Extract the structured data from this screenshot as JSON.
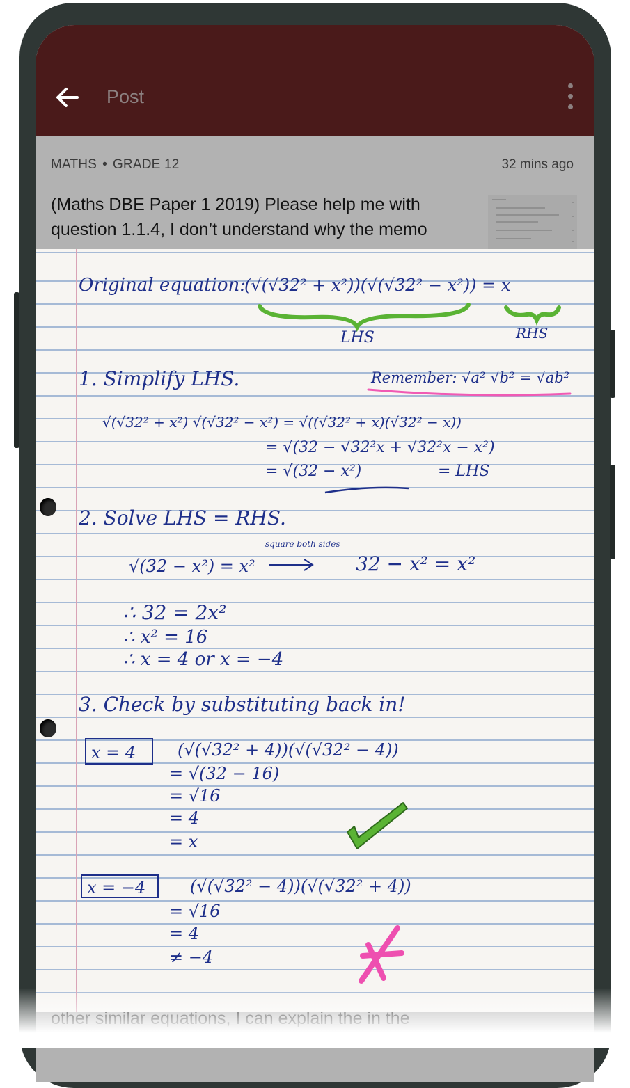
{
  "appbar": {
    "title": "Post",
    "back_icon": "arrow-left-icon",
    "menu_icon": "more-vertical-icon",
    "color": "#4a1a1a"
  },
  "post": {
    "subject": "MATHS",
    "separator": "•",
    "grade": "GRADE 12",
    "time": "32 mins ago",
    "text": "(Maths DBE Paper 1 2019) Please help me with question 1.1.4, I don’t understand why the memo",
    "footer_text": "other similar equations, I can explain the in the"
  },
  "notebook": {
    "line1_label": "Original equation:",
    "line1_eq": "(√(√32² + x²))(√(√32² − x²)) = x",
    "lhs": "LHS",
    "rhs": "RHS",
    "step1_title": "1. Simplify LHS.",
    "remember": "Remember: √a² √b² = √ab²",
    "step1_l1": "√(√32² + x²) √(√32² − x²)  =  √((√32² + x)(√32² − x))",
    "step1_l2": "=  √(32 − √32²x + √32²x − x²)",
    "step1_l3a": "=  √(32 − x²)",
    "step1_l3b": "=  LHS",
    "step2_title": "2.  Solve LHS = RHS.",
    "step2_l1a": "√(32 − x²)  =  x²",
    "step2_arrow_label": "square both sides",
    "step2_l1b": "32 − x² = x²",
    "step2_l2": "∴  32 = 2x²",
    "step2_l3": "∴  x² = 16",
    "step2_l4": "∴  x = 4    or    x = −4",
    "step3_title": "3.  Check by substituting back in!",
    "case1_box": "x = 4",
    "case1_l1": "(√(√32² + 4))(√(√32² − 4))",
    "case1_l2": "=   √(32 − 16)",
    "case1_l3": "=   √16",
    "case1_l4": "=   4",
    "case1_l5": "=   x",
    "case2_box": "x = −4",
    "case2_l1": "(√(√32² − 4))(√(√32² + 4))",
    "case2_l2": "=   √16",
    "case2_l3": "=   4",
    "case2_l4": "≠   −4",
    "colors": {
      "ink": "#1e2f8a",
      "brace": "#5ab334",
      "highlight": "#f05ab4",
      "check": "#5ab334",
      "cross": "#ee4fb0"
    }
  }
}
